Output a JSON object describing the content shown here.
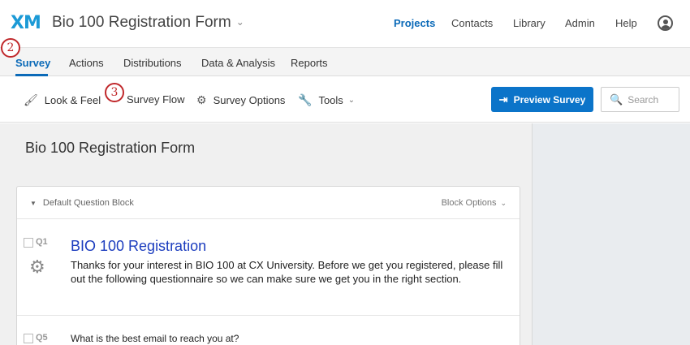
{
  "app": {
    "logo": "XM",
    "survey_title": "Bio 100 Registration Form",
    "title_chevron": "⌄"
  },
  "topnav": [
    "Projects",
    "Contacts",
    "Library",
    "Admin",
    "Help"
  ],
  "tabs": [
    "Survey",
    "Actions",
    "Distributions",
    "Data & Analysis",
    "Reports"
  ],
  "toolbar": {
    "look_feel": "Look & Feel",
    "survey_flow": "Survey Flow",
    "survey_options": "Survey Options",
    "tools": "Tools",
    "preview": "Preview Survey",
    "search_placeholder": "Search"
  },
  "annotations": {
    "a2": "2",
    "a3": "3"
  },
  "main": {
    "title": "Bio 100 Registration Form",
    "block_name": "Default Question Block",
    "block_options": "Block Options"
  },
  "questions": [
    {
      "id": "Q1",
      "title": "BIO 100 Registration",
      "text": "Thanks for your interest in BIO 100 at CX University. Before we get you registered, please fill out the following questionnaire so we can make sure we get you in the right section."
    },
    {
      "id": "Q5",
      "text": "What is the best email to reach you at?"
    }
  ],
  "colors": {
    "accent": "#0b6ab8",
    "preview_button": "#0b74c9",
    "annotation": "#c0282b",
    "question_title": "#1b3cbe"
  }
}
